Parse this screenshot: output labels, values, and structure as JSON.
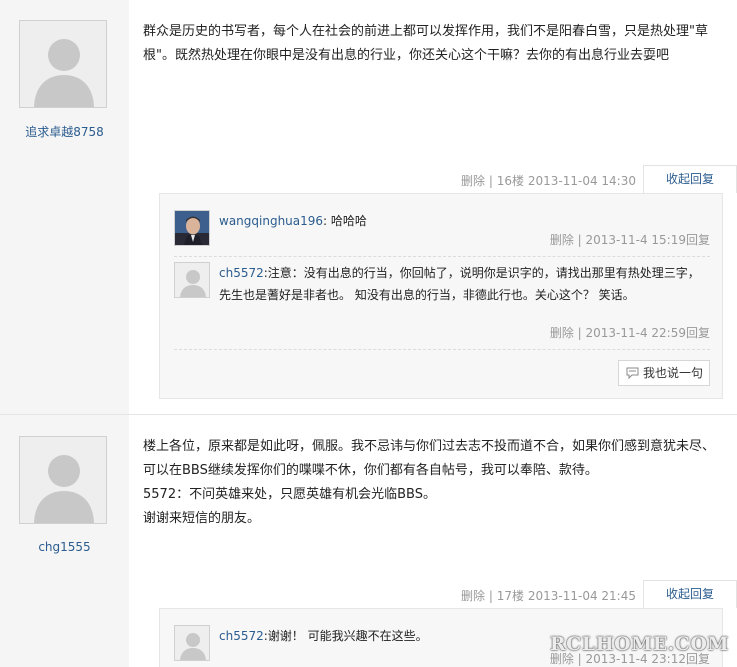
{
  "posts": [
    {
      "username": "追求卓越8758",
      "content": "群众是历史的书写者，每个人在社会的前进上都可以发挥作用，我们不是阳春白雪，只是热处理\"草根\"。既然热处理在你眼中是没有出息的行业，你还关心这个干嘛？去你的有出息行业去耍吧",
      "meta": {
        "delete": "删除",
        "sep": "|",
        "floor": "16楼",
        "time": "2013-11-04 14:30"
      },
      "toggle": "收起回复",
      "comments": [
        {
          "user": "wangqinghua196",
          "text": "哈哈哈",
          "meta": "删除 | 2013-11-4 15:19回复"
        },
        {
          "user": "ch5572",
          "text": "注意：没有出息的行当，你回帖了，说明你是识字的，请找出那里有热处理三字，先生也是蓍好是非者也。 知没有出息的行当，非德此行也。关心这个？ 笑话。",
          "meta": "删除 | 2013-11-4 22:59回复"
        }
      ],
      "say_button": "我也说一句"
    },
    {
      "username": "chg1555",
      "content_lines": [
        "楼上各位，原来都是如此呀，佩服。我不忌讳与你们过去志不投而道不合，如果你们感到意犹未尽、可以在BBS继续发挥你们的喋喋不休，你们都有各自帖号，我可以奉陪、款待。",
        "5572：不问英雄来处，只愿英雄有机会光临BBS。",
        "谢谢来短信的朋友。"
      ],
      "meta": {
        "delete": "删除",
        "sep": "|",
        "floor": "17楼",
        "time": "2013-11-04 21:45"
      },
      "toggle": "收起回复",
      "comments": [
        {
          "user": "ch5572",
          "text": "谢谢！ 可能我兴趣不在这些。",
          "meta": "删除 | 2013-11-4 23:12回复"
        }
      ]
    }
  ],
  "watermark": "RCLHOME.COM",
  "colors": {
    "link": "#2b5c8f",
    "muted": "#999999",
    "sidebar": "#f5f5f5",
    "comment_bg": "#f7f7f7"
  }
}
